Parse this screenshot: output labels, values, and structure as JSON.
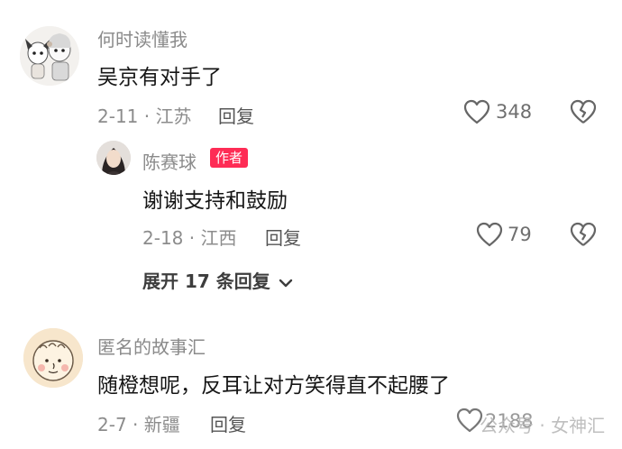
{
  "comments": [
    {
      "username": "何时读懂我",
      "text": "吴京有对手了",
      "date": "2-11 · 江苏",
      "reply_label": "回复",
      "likes": "348",
      "replies": [
        {
          "username": "陈赛球",
          "badge": "作者",
          "text": "谢谢支持和鼓励",
          "date": "2-18 · 江西",
          "reply_label": "回复",
          "likes": "79"
        }
      ],
      "expand_label": "展开 17 条回复"
    },
    {
      "username": "匿名的故事汇",
      "text": "随橙想呢，反耳让对方笑得直不起腰了",
      "date": "2-7 · 新疆",
      "reply_label": "回复",
      "likes": "2188"
    }
  ],
  "watermark": "公众号 · 女神汇",
  "colors": {
    "badge": "#fe2c55",
    "username": "#8a8a8a",
    "text": "#161616",
    "meta": "#8c8c8c"
  },
  "icons": {
    "like": "heart-outline-icon",
    "dislike": "broken-heart-icon",
    "expand": "chevron-down-icon"
  }
}
